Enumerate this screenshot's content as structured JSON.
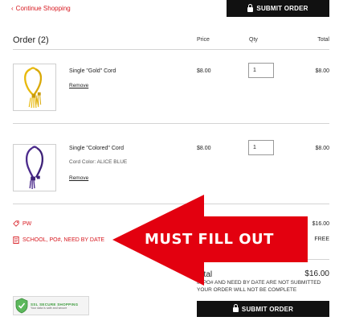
{
  "header": {
    "continue_label": "Continue Shopping",
    "submit_label": "SUBMIT ORDER"
  },
  "order": {
    "title": "Order (2)",
    "col_price": "Price",
    "col_qty": "Qty",
    "col_total": "Total"
  },
  "items": [
    {
      "name": "Single \"Gold\" Cord",
      "sub": "",
      "remove": "Remove",
      "price": "$8.00",
      "qty": "1",
      "total": "$8.00",
      "cord_color": "#e8b90c"
    },
    {
      "name": "Single \"Colored\" Cord",
      "sub": "Cord Color: ALICE BLUE",
      "remove": "Remove",
      "price": "$8.00",
      "qty": "1",
      "total": "$8.00",
      "cord_color": "#4b2a8c"
    }
  ],
  "summary": {
    "promo_code": "PW",
    "promo_value": "$16.00",
    "shipping_label": "SCHOOL, PO#, NEED BY DATE",
    "shipping_value": "FREE",
    "total_label": "Total",
    "total_value": "$16.00",
    "notice": "IF PO# AND NEED BY DATE ARE NOT SUBMITTED YOUR ORDER WILL NOT BE COMPLETE"
  },
  "annotation": {
    "text": "MUST FILL OUT",
    "color": "#e3000f"
  },
  "secure_badge": {
    "title": "SSL SECURE SHOPPING",
    "subtitle": "Your data is safe and secure"
  },
  "icons": {
    "back": "chevron-left-icon",
    "lock": "lock-icon",
    "tag": "tag-icon",
    "form": "form-icon",
    "shield": "shield-check-icon"
  },
  "colors": {
    "accent": "#d71920",
    "button": "#111111"
  }
}
